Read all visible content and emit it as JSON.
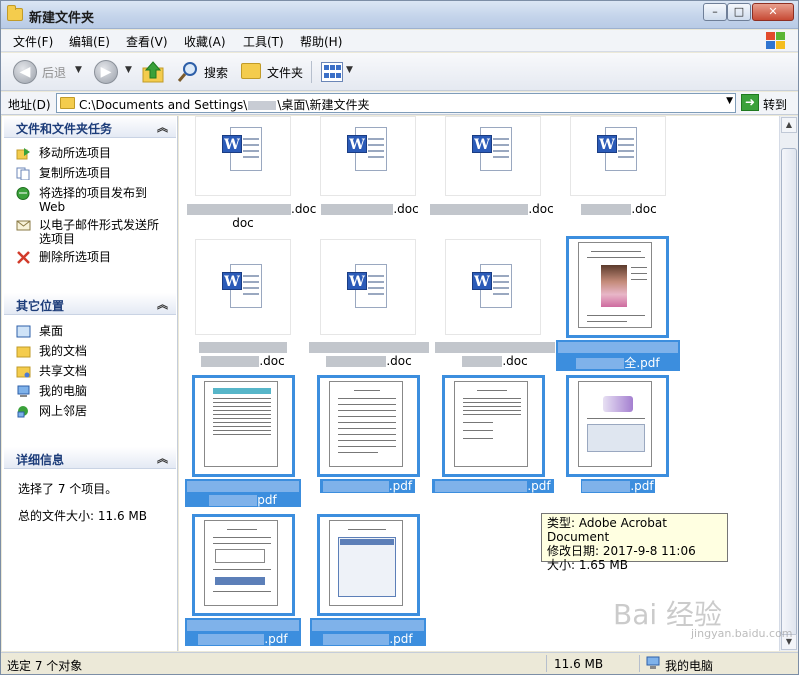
{
  "window": {
    "title": "新建文件夹"
  },
  "menu": [
    "文件(F)",
    "编辑(E)",
    "查看(V)",
    "收藏(A)",
    "工具(T)",
    "帮助(H)"
  ],
  "toolbar": {
    "back": "后退",
    "search": "搜索",
    "folders": "文件夹"
  },
  "address": {
    "label": "地址(D)",
    "path_start": "C:\\Documents and Settings\\",
    "path_end": "\\桌面\\新建文件夹",
    "go": "转到"
  },
  "tasks": {
    "title": "文件和文件夹任务",
    "items": [
      "移动所选项目",
      "复制所选项目",
      "将选择的项目发布到 Web",
      "以电子邮件形式发送所选项目",
      "删除所选项目"
    ]
  },
  "places": {
    "title": "其它位置",
    "items": [
      "桌面",
      "我的文档",
      "共享文档",
      "我的电脑",
      "网上邻居"
    ]
  },
  "details": {
    "title": "详细信息",
    "line1": "选择了 7 个项目。",
    "line2": "总的文件大小: 11.6 MB"
  },
  "files": [
    {
      "suffix": ".doc",
      "tail": "doc"
    },
    {
      "suffix": ".doc"
    },
    {
      "suffix": ".doc"
    },
    {
      "suffix": ".doc"
    },
    {
      "suffix": ".doc"
    },
    {
      "suffix": ".doc"
    },
    {
      "suffix": ".doc"
    },
    {
      "suffix": "全.pdf"
    },
    {
      "suffix": "pdf"
    },
    {
      "suffix": ".pdf"
    },
    {
      "suffix": ".pdf"
    },
    {
      "suffix": ".pdf"
    },
    {
      "suffix": ".pdf"
    },
    {
      "suffix": ".pdf"
    }
  ],
  "tooltip": {
    "type": "类型: Adobe Acrobat Document",
    "modified": "修改日期: 2017-9-8 11:06",
    "size": "大小: 1.65 MB"
  },
  "status": {
    "selection": "选定 7 个对象",
    "size": "11.6 MB",
    "location": "我的电脑"
  },
  "watermark": {
    "main": "Bai 经验",
    "sub": "jingyan.baidu.com"
  }
}
